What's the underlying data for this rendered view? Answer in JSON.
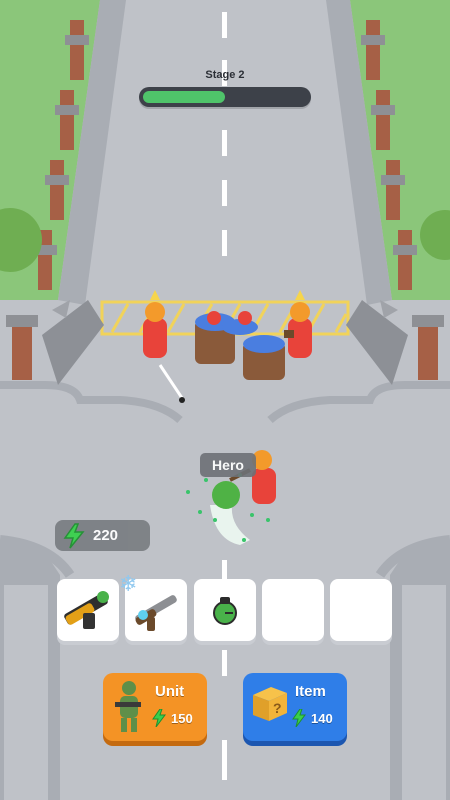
{
  "hud": {
    "stage_label": "Stage 2",
    "stage_progress": 0.5
  },
  "energy": {
    "value": "220",
    "icon": "lightning-bolt-icon"
  },
  "hero": {
    "label": "Hero"
  },
  "inventory": {
    "slots": [
      {
        "item": "rocket-launcher-icon",
        "filled": true
      },
      {
        "item": "frost-shotgun-icon",
        "filled": true,
        "badge": "snowflake-icon"
      },
      {
        "item": "grenade-icon",
        "filled": true
      },
      {
        "item": "",
        "filled": false
      },
      {
        "item": "",
        "filled": false
      }
    ]
  },
  "shop": {
    "unit": {
      "title": "Unit",
      "cost": "150",
      "icon": "soldier-icon"
    },
    "item": {
      "title": "Item",
      "cost": "140",
      "icon": "crate-icon"
    }
  },
  "colors": {
    "road": "#bfc2c8",
    "grass": "#8bc67a",
    "progress_fill": "#4fc46a",
    "unit_button": "#f49325",
    "item_button": "#2f7ee8",
    "energy_bolt": "#39d04c",
    "enemy": "#e8433a",
    "hero": "#4fb245"
  }
}
